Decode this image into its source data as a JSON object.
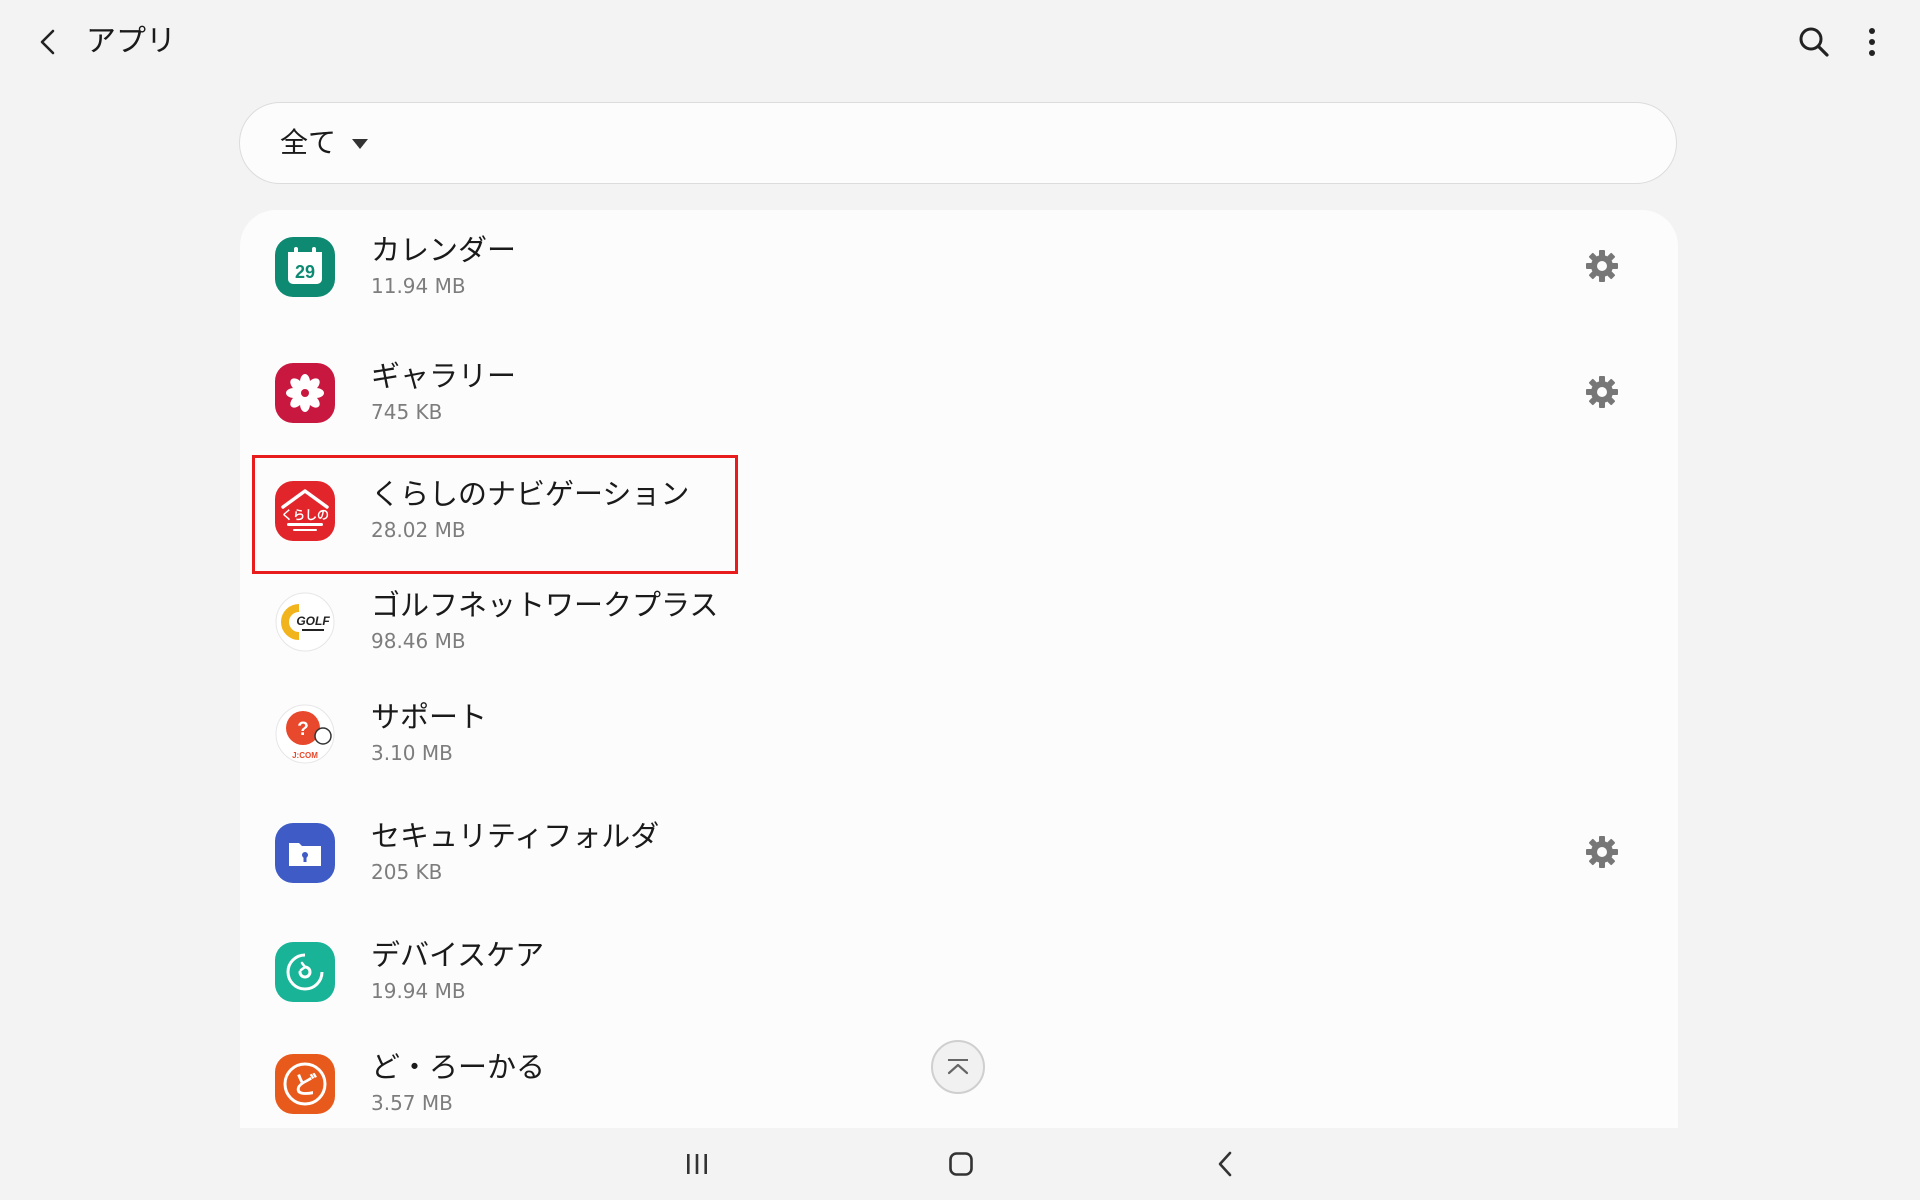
{
  "header": {
    "title": "アプリ"
  },
  "filter": {
    "label": "全て"
  },
  "apps": [
    {
      "name": "カレンダー",
      "size": "11.94 MB",
      "has_settings": true,
      "icon": "calendar-icon",
      "icon_text": "29",
      "color": "#0e8a73"
    },
    {
      "name": "ギャラリー",
      "size": "745 KB",
      "has_settings": true,
      "icon": "gallery-icon",
      "color": "#c9183f"
    },
    {
      "name": "くらしのナビゲーション",
      "size": "28.02 MB",
      "has_settings": false,
      "icon": "kurashi-navi-icon",
      "icon_text": "くらしの",
      "color": "#e2252b"
    },
    {
      "name": "ゴルフネットワークプラス",
      "size": "98.46 MB",
      "has_settings": false,
      "icon": "golf-network-icon",
      "icon_text": "GOLF",
      "color": "#f1b41c"
    },
    {
      "name": "サポート",
      "size": "3.10 MB",
      "has_settings": false,
      "icon": "support-icon",
      "icon_text": "J:COM",
      "color": "#e8482b"
    },
    {
      "name": "セキュリティフォルダ",
      "size": "205 KB",
      "has_settings": true,
      "icon": "secure-folder-icon",
      "color": "#3e5bc6"
    },
    {
      "name": "デバイスケア",
      "size": "19.94 MB",
      "has_settings": false,
      "icon": "device-care-icon",
      "color": "#19b397"
    },
    {
      "name": "ど・ろーかる",
      "size": "3.57 MB",
      "has_settings": false,
      "icon": "do-local-icon",
      "icon_text": "ど",
      "color": "#e85a1c"
    }
  ],
  "highlight_color": "#e81c1c"
}
